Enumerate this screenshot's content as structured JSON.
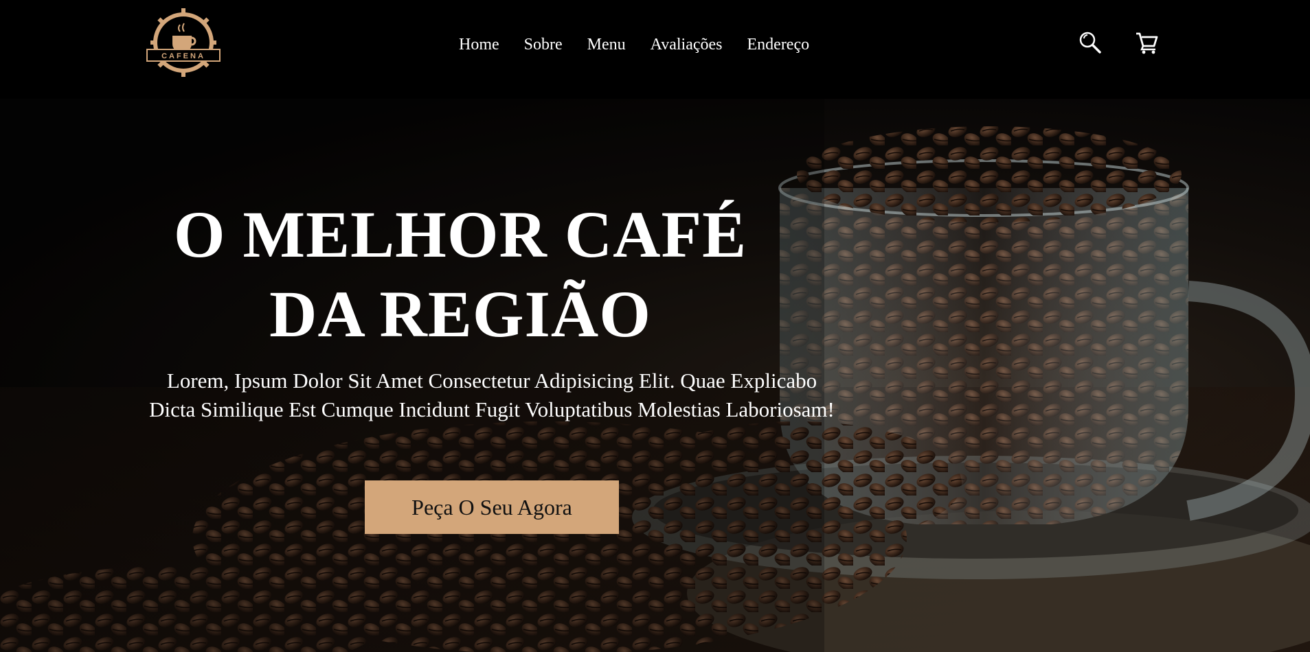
{
  "brand": {
    "logo_text": "CAFENA"
  },
  "nav": {
    "items": [
      {
        "label": "Home"
      },
      {
        "label": "Sobre"
      },
      {
        "label": "Menu"
      },
      {
        "label": "Avaliações"
      },
      {
        "label": "Endereço"
      }
    ]
  },
  "header_icons": {
    "search": "search-icon",
    "cart": "cart-icon"
  },
  "hero": {
    "title_line1": "O MELHOR CAFÉ",
    "title_line2": "DA REGIÃO",
    "subtitle": "Lorem, Ipsum Dolor Sit Amet Consectetur Adipisicing Elit. Quae Explicabo Dicta Similique Est Cumque Incidunt Fugit Voluptatibus Molestias Laboriosam!",
    "cta_label": "Peça O Seu Agora"
  },
  "colors": {
    "header_bg": "#000000",
    "accent": "#d3a67a",
    "text": "#ffffff"
  }
}
